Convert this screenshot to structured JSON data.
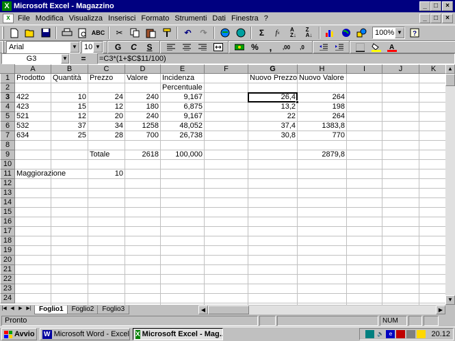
{
  "window": {
    "title": "Microsoft Excel - Magazzino",
    "app_icon": "excel-icon",
    "buttons": [
      "_",
      " □",
      "×"
    ]
  },
  "menu": [
    "File",
    "Modifica",
    "Visualizza",
    "Inserisci",
    "Formato",
    "Strumenti",
    "Dati",
    "Finestra",
    "?"
  ],
  "toolbar1": {
    "icons": [
      "new-icon",
      "open-icon",
      "save-icon",
      "print-icon",
      "print-preview-icon",
      "spelling-icon",
      "cut-icon",
      "copy-icon",
      "paste-icon",
      "format-painter-icon",
      "undo-icon",
      "redo-icon",
      "hyperlink-icon",
      "web-toolbar-icon",
      "autosum-icon",
      "function-icon",
      "sort-ascending-icon",
      "sort-descending-icon",
      "chart-wizard-icon",
      "map-icon",
      "drawing-icon",
      "help-icon"
    ],
    "zoom": "100%"
  },
  "toolbar2": {
    "font": "Arial",
    "size": "10",
    "format_labels": [
      "G",
      "C",
      "S"
    ],
    "icons": [
      "align-left-icon",
      "center-icon",
      "align-right-icon",
      "merge-center-icon",
      "currency-icon",
      "percent-icon",
      "comma-icon",
      "increase-decimal-icon",
      "decrease-decimal-icon",
      "decrease-indent-icon",
      "increase-indent-icon",
      "borders-icon",
      "fill-color-icon",
      "font-color-icon"
    ]
  },
  "formula_bar": {
    "name_box": "G3",
    "equals": "=",
    "formula": "=C3*(1+$C$11/100)"
  },
  "columns": [
    "A",
    "B",
    "C",
    "D",
    "E",
    "F",
    "G",
    "H",
    "I",
    "J",
    "K"
  ],
  "active_column": "G",
  "active_row": 3,
  "row_count": 24,
  "cells": {
    "A1": "Prodotto",
    "B1": "Quantità",
    "C1": "Prezzo",
    "D1": "Valore",
    "E1": "Incidenza",
    "G1": "Nuovo Prezzo",
    "H1": "Nuovo Valore",
    "E2": "Percentuale",
    "A3": "422",
    "B3": "10",
    "C3": "24",
    "D3": "240",
    "E3": "9,167",
    "G3": "26,4",
    "H3": "264",
    "A4": "423",
    "B4": "15",
    "C4": "12",
    "D4": "180",
    "E4": "6,875",
    "G4": "13,2",
    "H4": "198",
    "A5": "521",
    "B5": "12",
    "C5": "20",
    "D5": "240",
    "E5": "9,167",
    "G5": "22",
    "H5": "264",
    "A6": "532",
    "B6": "37",
    "C6": "34",
    "D6": "1258",
    "E6": "48,052",
    "G6": "37,4",
    "H6": "1383,8",
    "A7": "634",
    "B7": "25",
    "C7": "28",
    "D7": "700",
    "E7": "26,738",
    "G7": "30,8",
    "H7": "770",
    "C9": "Totale",
    "D9": "2618",
    "E9": "100,000",
    "H9": "2879,8",
    "A11": "Maggiorazione",
    "C11": "10"
  },
  "sheets": [
    "Foglio1",
    "Foglio2",
    "Foglio3"
  ],
  "active_sheet": "Foglio1",
  "status": {
    "text": "Pronto",
    "num": "NUM"
  },
  "taskbar": {
    "start": "Avvio",
    "tasks": [
      {
        "label": "Microsoft Word - Excel",
        "icon": "word-icon",
        "active": false
      },
      {
        "label": "Microsoft Excel - Mag...",
        "icon": "excel-icon",
        "active": true
      }
    ],
    "tray_icons": [
      "network-icon",
      "volume-icon",
      "ie-icon",
      "task-scheduler-icon",
      "printer-icon",
      "antivirus-icon"
    ],
    "clock": "20.12"
  },
  "colors": {
    "title_bar": "#000080",
    "face": "#c0c0c0",
    "grid_lines": "#c0c0c0"
  }
}
